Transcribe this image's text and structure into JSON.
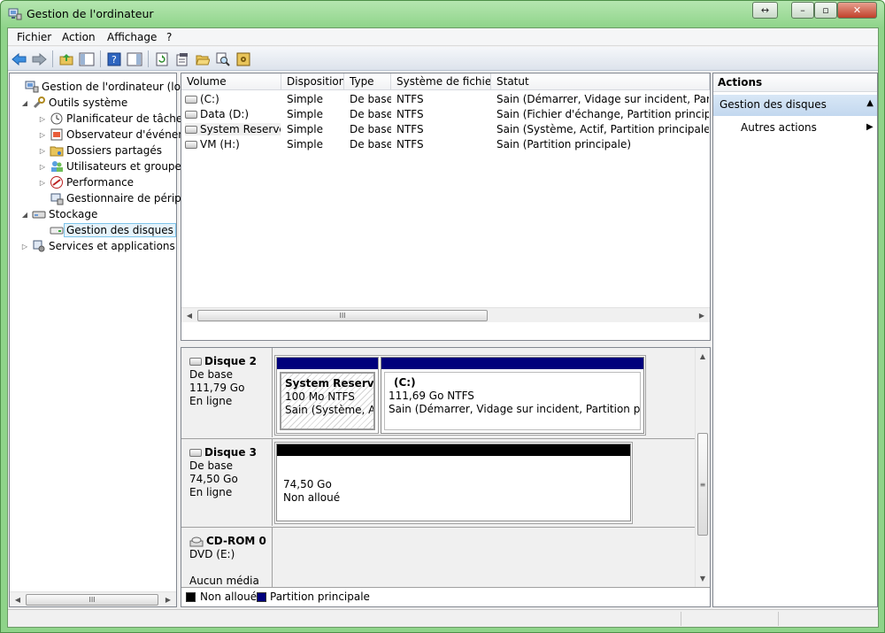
{
  "window": {
    "title": "Gestion de l'ordinateur",
    "buttons": {
      "restore_icon": "↔",
      "minimize": "–",
      "maximize": "▫",
      "close": "✕"
    }
  },
  "menu": [
    "Fichier",
    "Action",
    "Affichage",
    "?"
  ],
  "tree": {
    "items": [
      {
        "label": "Gestion de l'ordinateur (local)",
        "icon": "computer-management-icon",
        "level": 0,
        "arrow": ""
      },
      {
        "label": "Outils système",
        "icon": "tools-icon",
        "level": 1,
        "arrow": "◢"
      },
      {
        "label": "Planificateur de tâches",
        "icon": "clock-icon",
        "level": 2,
        "arrow": "▷"
      },
      {
        "label": "Observateur d'événeme",
        "icon": "event-viewer-icon",
        "level": 2,
        "arrow": "▷"
      },
      {
        "label": "Dossiers partagés",
        "icon": "shared-folder-icon",
        "level": 2,
        "arrow": "▷"
      },
      {
        "label": "Utilisateurs et groupes l",
        "icon": "users-icon",
        "level": 2,
        "arrow": "▷"
      },
      {
        "label": "Performance",
        "icon": "performance-icon",
        "level": 2,
        "arrow": "▷"
      },
      {
        "label": "Gestionnaire de périphé",
        "icon": "device-manager-icon",
        "level": 2,
        "arrow": ""
      },
      {
        "label": "Stockage",
        "icon": "storage-icon",
        "level": 1,
        "arrow": "◢"
      },
      {
        "label": "Gestion des disques",
        "icon": "disk-management-icon",
        "level": 2,
        "arrow": "",
        "selected": true
      },
      {
        "label": "Services et applications",
        "icon": "services-icon",
        "level": 1,
        "arrow": "▷"
      }
    ]
  },
  "volumes": {
    "headers": [
      "Volume",
      "Disposition",
      "Type",
      "Système de fichiers",
      "Statut"
    ],
    "rows": [
      [
        "(C:)",
        "Simple",
        "De base",
        "NTFS",
        "Sain (Démarrer, Vidage sur incident, Partition"
      ],
      [
        "Data (D:)",
        "Simple",
        "De base",
        "NTFS",
        "Sain (Fichier d'échange, Partition principale)"
      ],
      [
        "System Reserved",
        "Simple",
        "De base",
        "NTFS",
        "Sain (Système, Actif, Partition principale)"
      ],
      [
        "VM (H:)",
        "Simple",
        "De base",
        "NTFS",
        "Sain (Partition principale)"
      ]
    ]
  },
  "disks": {
    "disk2": {
      "name": "Disque 2",
      "type": "De base",
      "size": "111,79 Go",
      "state": "En ligne",
      "p1": {
        "name": "System Reserved",
        "size": "100 Mo NTFS",
        "status": "Sain (Système, Actif"
      },
      "p2": {
        "name": "(C:)",
        "size": "111,69 Go NTFS",
        "status": "Sain (Démarrer, Vidage sur incident, Partition principal"
      }
    },
    "disk3": {
      "name": "Disque 3",
      "type": "De base",
      "size": "74,50 Go",
      "state": "En ligne",
      "p1": {
        "size": "74,50 Go",
        "status": "Non alloué"
      }
    },
    "cdrom0": {
      "name": "CD-ROM 0",
      "type": "DVD (E:)",
      "state": "Aucun média"
    }
  },
  "legend": {
    "unallocated": "Non alloué",
    "primary": "Partition principale"
  },
  "actions": {
    "header": "Actions",
    "section": "Gestion des disques",
    "more": "Autres actions"
  },
  "scroll_glyph": "III",
  "colors": {
    "primary_partition": "#00007c",
    "unallocated": "#000000",
    "selection": "#c3d8ef",
    "window_frame": "#8fd48a"
  }
}
